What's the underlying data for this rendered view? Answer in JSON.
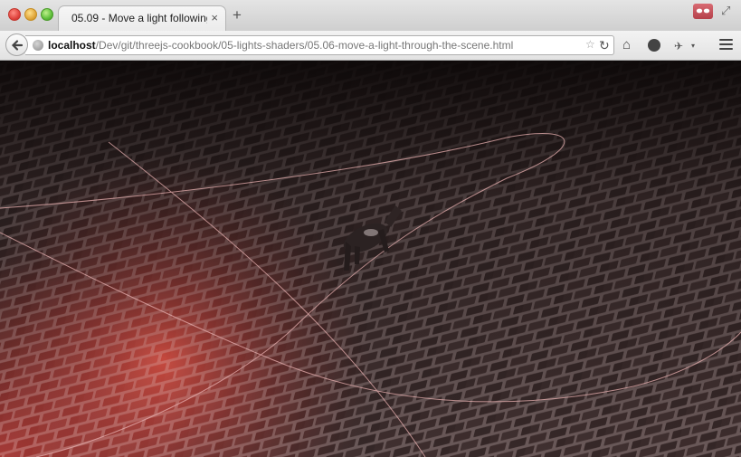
{
  "tab": {
    "title": "05.09 - Move a light following...",
    "close_glyph": "×"
  },
  "new_tab_glyph": "+",
  "url": {
    "host": "localhost",
    "path": "/Dev/git/threejs-cookbook/05-lights-shaders/05.06-move-a-light-through-the-scene.html"
  },
  "icons": {
    "back": "back-arrow-icon",
    "star": "☆",
    "reload": "↻",
    "home": "⌂",
    "ext": "✈",
    "dropdown": "▾",
    "fullscreen": "⤢"
  },
  "scene": {
    "description_colors": {
      "brick": "#4a3a3a",
      "mortar": "#8a7a7a",
      "light": "#ff3b2a"
    }
  }
}
